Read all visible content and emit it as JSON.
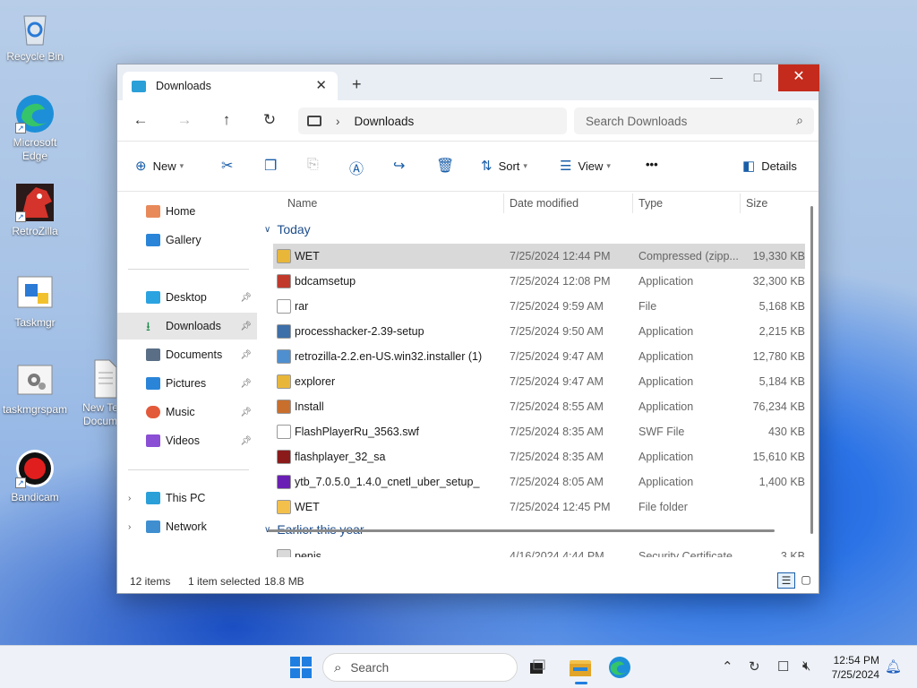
{
  "desktop": {
    "icons": [
      {
        "label": "Recycle Bin"
      },
      {
        "label": "Microsoft Edge"
      },
      {
        "label": "RetroZilla"
      },
      {
        "label": "Taskmgr"
      },
      {
        "label": "taskmgrspam"
      },
      {
        "label": "New Te... Docum..."
      },
      {
        "label": "Bandicam"
      }
    ]
  },
  "window": {
    "tab_title": "Downloads",
    "new_tab_glyph": "+",
    "close_tab_glyph": "✕",
    "breadcrumb_location": "Downloads",
    "search_placeholder": "Search Downloads"
  },
  "toolbar": {
    "new_label": "New",
    "sort_label": "Sort",
    "view_label": "View",
    "more_label": "•••",
    "details_label": "Details"
  },
  "sidebar": {
    "items": [
      {
        "label": "Home",
        "icon": "home-icon"
      },
      {
        "label": "Gallery",
        "icon": "gallery-icon"
      },
      {
        "label": "Desktop",
        "icon": "desktop-icon"
      },
      {
        "label": "Downloads",
        "icon": "downloads-icon"
      },
      {
        "label": "Documents",
        "icon": "documents-icon"
      },
      {
        "label": "Pictures",
        "icon": "pictures-icon"
      },
      {
        "label": "Music",
        "icon": "music-icon"
      },
      {
        "label": "Videos",
        "icon": "videos-icon"
      },
      {
        "label": "This PC",
        "icon": "this-pc-icon"
      },
      {
        "label": "Network",
        "icon": "network-icon"
      }
    ]
  },
  "columns": {
    "name": "Name",
    "date": "Date modified",
    "type": "Type",
    "size": "Size"
  },
  "groups": {
    "today": "Today",
    "earlier": "Earlier this year"
  },
  "files": [
    {
      "name": "WET",
      "date": "7/25/2024 12:44 PM",
      "type": "Compressed (zipp...",
      "size": "19,330 KB",
      "icon": "zip-folder-icon",
      "color": "#e8b73a"
    },
    {
      "name": "bdcamsetup",
      "date": "7/25/2024 12:08 PM",
      "type": "Application",
      "size": "32,300 KB",
      "icon": "bandicam-setup-icon",
      "color": "#c0392b"
    },
    {
      "name": "rar",
      "date": "7/25/2024 9:59 AM",
      "type": "File",
      "size": "5,168 KB",
      "icon": "blank-file-icon",
      "color": "#ffffff"
    },
    {
      "name": "processhacker-2.39-setup",
      "date": "7/25/2024 9:50 AM",
      "type": "Application",
      "size": "2,215 KB",
      "icon": "installer-icon",
      "color": "#3d6fa8"
    },
    {
      "name": "retrozilla-2.2.en-US.win32.installer (1)",
      "date": "7/25/2024 9:47 AM",
      "type": "Application",
      "size": "12,780 KB",
      "icon": "installer-icon",
      "color": "#4f8fcf"
    },
    {
      "name": "explorer",
      "date": "7/25/2024 9:47 AM",
      "type": "Application",
      "size": "5,184 KB",
      "icon": "explorer-app-icon",
      "color": "#e8b73a"
    },
    {
      "name": "Install",
      "date": "7/25/2024 8:55 AM",
      "type": "Application",
      "size": "76,234 KB",
      "icon": "install-icon",
      "color": "#c96f2d"
    },
    {
      "name": "FlashPlayerRu_3563.swf",
      "date": "7/25/2024 8:35 AM",
      "type": "SWF File",
      "size": "430 KB",
      "icon": "blank-file-icon",
      "color": "#ffffff"
    },
    {
      "name": "flashplayer_32_sa",
      "date": "7/25/2024 8:35 AM",
      "type": "Application",
      "size": "15,610 KB",
      "icon": "flash-icon",
      "color": "#8b1a1a"
    },
    {
      "name": "ytb_7.0.5.0_1.4.0_cnetl_uber_setup_",
      "date": "7/25/2024 8:05 AM",
      "type": "Application",
      "size": "1,400 KB",
      "icon": "yahoo-icon",
      "color": "#6a1fb4"
    },
    {
      "name": "WET",
      "date": "7/25/2024 12:45 PM",
      "type": "File folder",
      "size": "",
      "icon": "folder-icon",
      "color": "#f3c14b"
    }
  ],
  "earlier_files": [
    {
      "name": "penis",
      "date": "4/16/2024 4:44 PM",
      "type": "Security Certificate",
      "size": "3 KB",
      "icon": "certificate-icon",
      "color": "#d9d9d9"
    }
  ],
  "status": {
    "items": "12 items",
    "selected": "1 item selected",
    "size": "18.8 MB"
  },
  "taskbar": {
    "search_label": "Search",
    "time": "12:54 PM",
    "date": "7/25/2024"
  }
}
